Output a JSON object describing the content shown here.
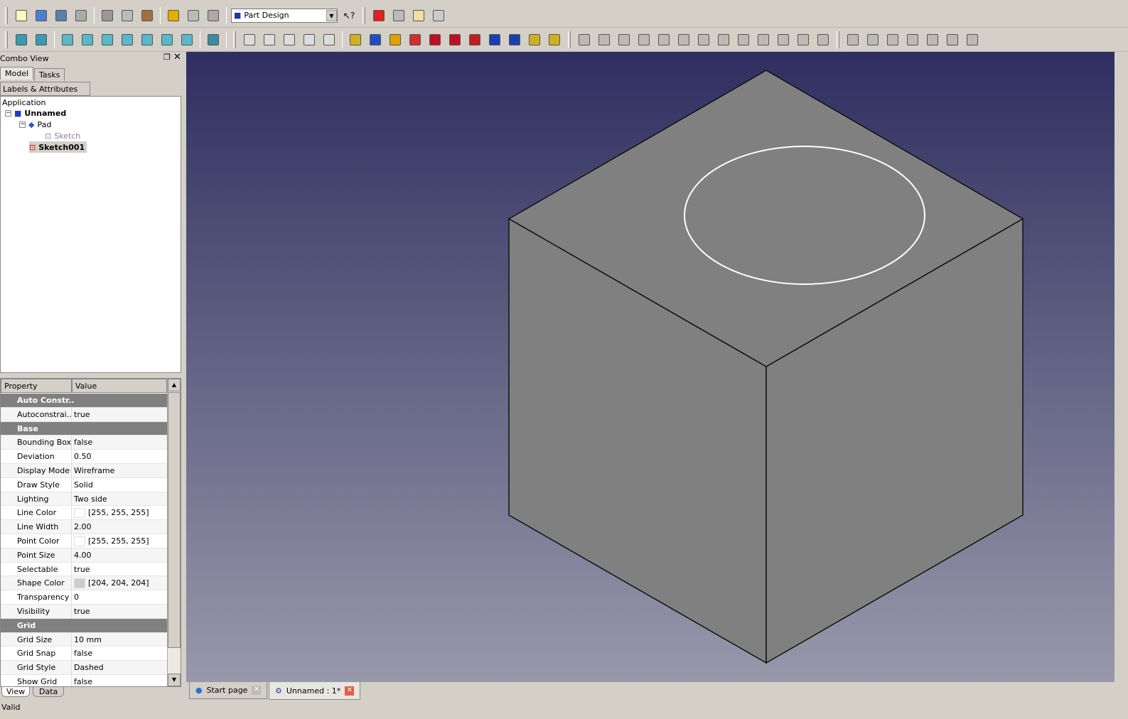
{
  "toolbar1": {
    "icons": [
      "new-document",
      "open-folder",
      "save",
      "print",
      "cut",
      "copy",
      "paste",
      "undo",
      "redo",
      "refresh"
    ],
    "workbench": "Part Design",
    "macro_icons": [
      "record-macro",
      "stop-macro",
      "edit-macro",
      "run-macro"
    ]
  },
  "toolbar2": {
    "icons": [
      "fit-all",
      "draw-style",
      "isometric-view",
      "front-view",
      "top-view",
      "right-view",
      "rear-view",
      "bottom-view",
      "left-view",
      "measure",
      "new-sketch",
      "import",
      "export",
      "sketch-view",
      "sketch-attach",
      "pad",
      "pocket",
      "revolve",
      "groove",
      "fillet",
      "chamfer",
      "draft",
      "mirror",
      "linear-pattern",
      "polar-pattern",
      "multi-transform"
    ],
    "sketch_icons": [
      "point",
      "line",
      "arc",
      "circle",
      "conic",
      "polyline",
      "rectangle",
      "polygon",
      "slot",
      "fillet",
      "trim",
      "external",
      "construction",
      "coincident",
      "point-on-object",
      "vertical",
      "horizontal",
      "parallel",
      "perpendicular",
      "tangent"
    ]
  },
  "combo": {
    "title": "Combo View",
    "tabs": [
      "Model",
      "Tasks"
    ],
    "tree_header": "Labels & Attributes",
    "tree": {
      "root": "Application",
      "doc": "Unnamed",
      "items": [
        "Pad",
        "Sketch",
        "Sketch001"
      ]
    }
  },
  "props": {
    "headers": [
      "Property",
      "Value"
    ],
    "rows": [
      {
        "group": "Auto Constr.."
      },
      {
        "k": "Autoconstrai...",
        "v": "true"
      },
      {
        "group": "Base"
      },
      {
        "k": "Bounding Box",
        "v": "false"
      },
      {
        "k": "Deviation",
        "v": "0.50"
      },
      {
        "k": "Display Mode",
        "v": "Wireframe"
      },
      {
        "k": "Draw Style",
        "v": "Solid"
      },
      {
        "k": "Lighting",
        "v": "Two side"
      },
      {
        "k": "Line Color",
        "v": "[255, 255, 255]",
        "swatch": "#ffffff"
      },
      {
        "k": "Line Width",
        "v": "2.00"
      },
      {
        "k": "Point Color",
        "v": "[255, 255, 255]",
        "swatch": "#ffffff"
      },
      {
        "k": "Point Size",
        "v": "4.00"
      },
      {
        "k": "Selectable",
        "v": "true"
      },
      {
        "k": "Shape Color",
        "v": "[204, 204, 204]",
        "swatch": "#cccccc"
      },
      {
        "k": "Transparency",
        "v": "0"
      },
      {
        "k": "Visibility",
        "v": "true"
      },
      {
        "group": "Grid"
      },
      {
        "k": "Grid Size",
        "v": "10 mm"
      },
      {
        "k": "Grid Snap",
        "v": "false"
      },
      {
        "k": "Grid Style",
        "v": "Dashed"
      },
      {
        "k": "Show Grid",
        "v": "false"
      }
    ],
    "tabs": [
      "View",
      "Data"
    ]
  },
  "doc_tabs": [
    "Start page",
    "Unnamed : 1*"
  ],
  "status": "Valid"
}
